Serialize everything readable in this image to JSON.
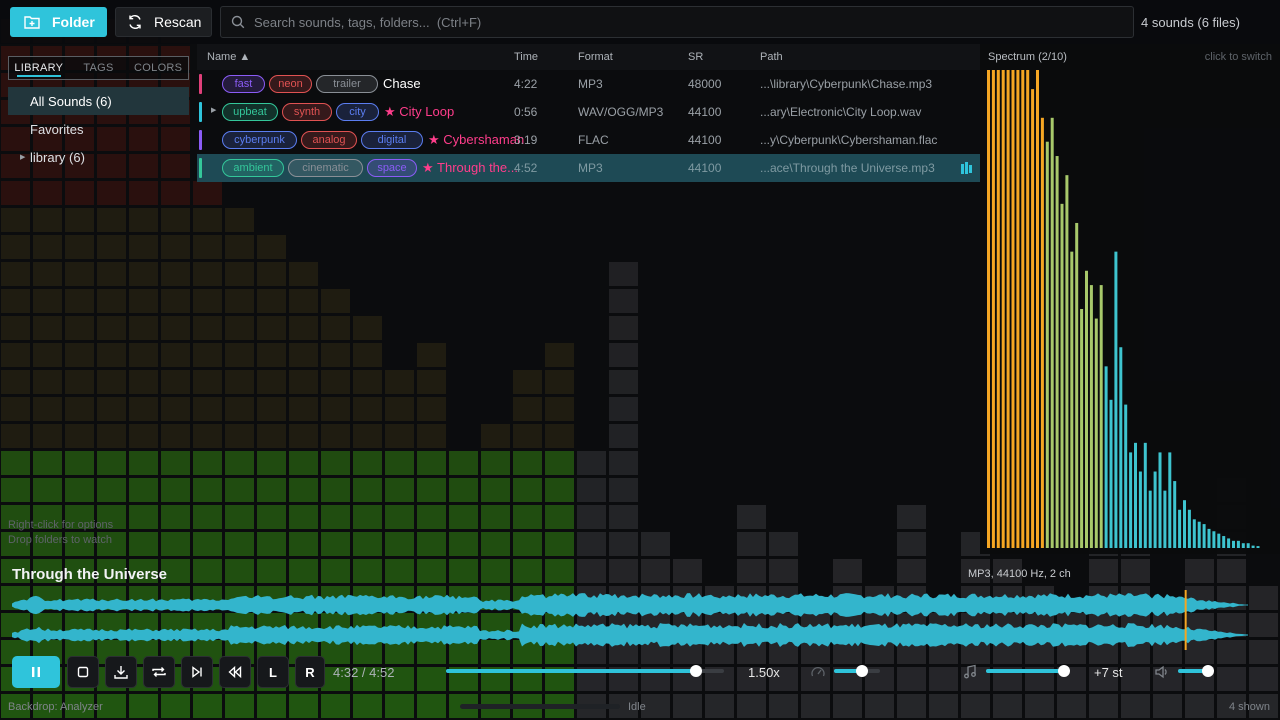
{
  "toolbar": {
    "folder_label": "Folder",
    "rescan_label": "Rescan",
    "search_placeholder": "Search sounds, tags, folders...  (Ctrl+F)",
    "count_text": "4 sounds (6 files)"
  },
  "sidebar": {
    "tabs": [
      {
        "label": "LIBRARY",
        "active": true
      },
      {
        "label": "TAGS",
        "active": false
      },
      {
        "label": "COLORS",
        "active": false
      }
    ],
    "items": [
      {
        "label": "All Sounds  (6)",
        "active": true
      },
      {
        "label": "Favorites",
        "active": false
      },
      {
        "label": "library  (6)",
        "active": false,
        "expandable": true
      }
    ],
    "hints": [
      "Right-click for options",
      "Drop folders to watch"
    ]
  },
  "list": {
    "columns": {
      "name": "Name ▲",
      "time": "Time",
      "format": "Format",
      "sr": "SR",
      "path": "Path"
    },
    "rows": [
      {
        "color": "#e0407a",
        "tags": [
          {
            "text": "fast",
            "color": "#8b5cf6"
          },
          {
            "text": "neon",
            "color": "#e05252"
          },
          {
            "text": "trailer",
            "color": "#8a8f96"
          }
        ],
        "name": "Chase",
        "favorite": false,
        "name_color": "#ffffff",
        "time": "4:22",
        "format": "MP3",
        "sr": "48000",
        "path": "...\\library\\Cyberpunk\\Chase.mp3",
        "selected": false,
        "expandable": false
      },
      {
        "color": "#2fc4db",
        "tags": [
          {
            "text": "upbeat",
            "color": "#34c79a"
          },
          {
            "text": "synth",
            "color": "#e05252"
          },
          {
            "text": "city",
            "color": "#5b7df0"
          }
        ],
        "name": "★ City Loop",
        "favorite": true,
        "name_color": "#ff3d8b",
        "time": "0:56",
        "format": "WAV/OGG/MP3",
        "sr": "44100",
        "path": "...ary\\Electronic\\City Loop.wav",
        "selected": false,
        "expandable": true
      },
      {
        "color": "#8b5cf6",
        "tags": [
          {
            "text": "cyberpunk",
            "color": "#5b7df0"
          },
          {
            "text": "analog",
            "color": "#e05252"
          },
          {
            "text": "digital",
            "color": "#5b7df0"
          }
        ],
        "name": "★ Cybershaman",
        "favorite": true,
        "name_color": "#ff3d8b",
        "time": "3:19",
        "format": "FLAC",
        "sr": "44100",
        "path": "...y\\Cyberpunk\\Cybershaman.flac",
        "selected": false,
        "expandable": false
      },
      {
        "color": "#34c79a",
        "tags": [
          {
            "text": "ambient",
            "color": "#34c79a"
          },
          {
            "text": "cinematic",
            "color": "#8a8f96"
          },
          {
            "text": "space",
            "color": "#8b5cf6"
          }
        ],
        "name": "★ Through the...",
        "favorite": true,
        "name_color": "#ff3d8b",
        "time": "4:52",
        "format": "MP3",
        "sr": "44100",
        "path": "...ace\\Through the Universe.mp3",
        "selected": true,
        "expandable": false
      }
    ]
  },
  "spectrum": {
    "title": "Spectrum  (2/10)",
    "hint": "click to switch",
    "levels": [
      1.0,
      1.0,
      1.0,
      1.0,
      1.0,
      1.0,
      1.0,
      1.0,
      1.0,
      0.96,
      1.0,
      0.9,
      0.85,
      0.9,
      0.82,
      0.72,
      0.78,
      0.62,
      0.68,
      0.5,
      0.58,
      0.55,
      0.48,
      0.55,
      0.38,
      0.31,
      0.62,
      0.42,
      0.3,
      0.2,
      0.22,
      0.16,
      0.22,
      0.12,
      0.16,
      0.2,
      0.12,
      0.2,
      0.14,
      0.08,
      0.1,
      0.08,
      0.06,
      0.055,
      0.05,
      0.04,
      0.035,
      0.03,
      0.025,
      0.02,
      0.015,
      0.015,
      0.01,
      0.01,
      0.005,
      0.004
    ],
    "colors": {
      "low": "#f5a623",
      "mid": "#a8c96b",
      "high": "#3ec4cf"
    }
  },
  "player": {
    "title": "Through the Universe",
    "info": "MP3, 44100 Hz, 2 ch",
    "time": "4:32 / 4:52",
    "progress": 0.93,
    "speed": "1.50x",
    "speed_position": 0.9,
    "tempo_position": 0.6,
    "pitch": "+7 st",
    "pitch_position": 0.98,
    "volume_position": 0.95,
    "controls": {
      "loop_left": "L",
      "loop_right": "R"
    },
    "wave_color": "#33b5cc",
    "playhead_color": "#f5a623"
  },
  "statusbar": {
    "backdrop": "Backdrop: Analyzer",
    "state": "Idle",
    "shown": "4 shown"
  }
}
